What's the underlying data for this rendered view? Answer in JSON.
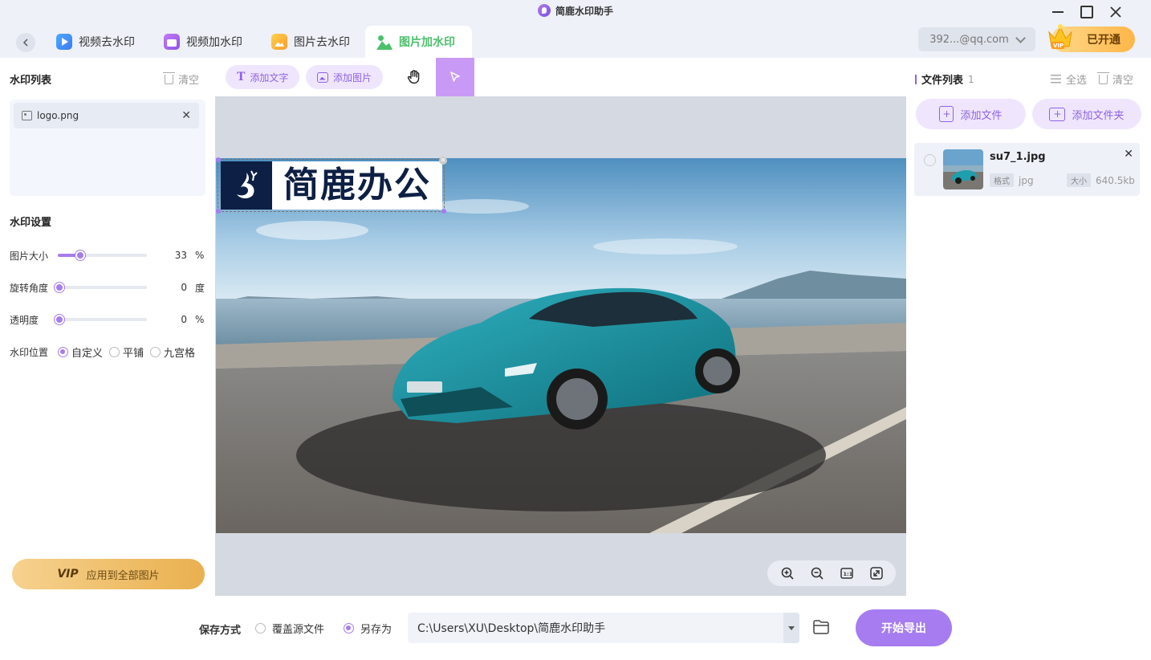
{
  "app": {
    "title": "简鹿水印助手"
  },
  "tabs": [
    {
      "label": "视频去水印",
      "icon": "video-icon",
      "active": false
    },
    {
      "label": "视频加水印",
      "icon": "video-watermark-icon",
      "active": false
    },
    {
      "label": "图片去水印",
      "icon": "image-icon",
      "active": false
    },
    {
      "label": "图片加水印",
      "icon": "image-watermark-icon",
      "active": true
    }
  ],
  "header": {
    "account": "392...@qq.com",
    "vip_button": "已开通"
  },
  "left": {
    "watermark_list_title": "水印列表",
    "clear_label": "清空",
    "items": [
      {
        "name": "logo.png"
      }
    ],
    "settings_title": "水印设置",
    "image_size": {
      "label": "图片大小",
      "value": 33,
      "unit": "%"
    },
    "rotation": {
      "label": "旋转角度",
      "value": 0,
      "unit": "度"
    },
    "opacity": {
      "label": "透明度",
      "value": 0,
      "unit": "%"
    },
    "position": {
      "label": "水印位置",
      "options": [
        "自定义",
        "平铺",
        "九宫格"
      ],
      "selected": "自定义"
    },
    "apply_vip": "VIP",
    "apply_label": "应用到全部图片"
  },
  "toolbar": {
    "add_text": "添加文字",
    "add_image": "添加图片"
  },
  "watermark_preview": {
    "text": "简鹿办公"
  },
  "right": {
    "file_list_title": "文件列表",
    "file_count": "1",
    "select_all": "全选",
    "clear": "清空",
    "add_file": "添加文件",
    "add_folder": "添加文件夹",
    "files": [
      {
        "name": "su7_1.jpg",
        "format_label": "格式",
        "format": "jpg",
        "size_label": "大小",
        "size": "640.5kb"
      }
    ]
  },
  "bottom": {
    "save_label": "保存方式",
    "overwrite": "覆盖源文件",
    "save_as": "另存为",
    "selected": "另存为",
    "path": "C:\\Users\\XU\\Desktop\\简鹿水印助手",
    "export": "开始导出"
  },
  "colors": {
    "accent": "#a67cf0",
    "tab_active": "#4cc06b",
    "vip_gold": "#ffb648"
  }
}
